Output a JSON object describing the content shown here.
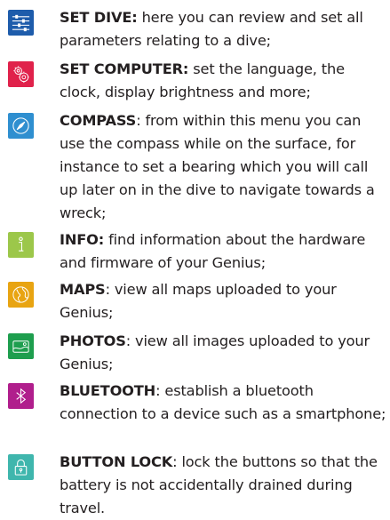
{
  "items": [
    {
      "title": "SET DIVE:",
      "description": " here you can review and set all parameters relating to a dive;",
      "icon": "sliders-icon",
      "color": "#1e5cab"
    },
    {
      "title": "SET COMPUTER:",
      "description": " set the language, the clock, display brightness and more;",
      "icon": "gears-icon",
      "color": "#e0224b"
    },
    {
      "title": "COMPASS",
      "description": ": from within this menu you can use the compass while on the surface, for instance to set a bearing which you will call up later on in the dive to navigate towards a wreck;",
      "icon": "compass-icon",
      "color": "#2f8fd0"
    },
    {
      "title": "INFO:",
      "description": " find information about the hardware and firmware of your Genius;",
      "icon": "info-icon",
      "color": "#9cc74a"
    },
    {
      "title": "MAPS",
      "description": ": view all maps uploaded to your Genius;",
      "icon": "globe-icon",
      "color": "#e8a412"
    },
    {
      "title": "PHOTOS",
      "description": ": view all images uploaded to your Genius;",
      "icon": "photo-icon",
      "color": "#1e9e4e"
    },
    {
      "title": "BLUETOOTH",
      "description": ": establish a bluetooth connection to a device such as a smartphone;",
      "icon": "bluetooth-icon",
      "color": "#b01e8c"
    },
    {
      "title": "BUTTON LOCK",
      "description": ": lock the buttons so that the battery is not accidentally drained during travel.",
      "icon": "lock-icon",
      "color": "#3fb6ad"
    }
  ]
}
